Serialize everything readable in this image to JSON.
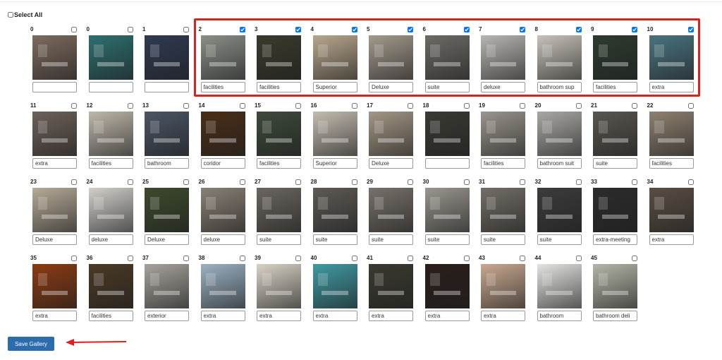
{
  "select_all_label": "Select All",
  "save_button": "Save Gallery",
  "annotation_color": "#e11d1d",
  "images": [
    {
      "id": "0",
      "caption": "",
      "checked": false,
      "tone": "#7d6b5e"
    },
    {
      "id": "0",
      "caption": "",
      "checked": false,
      "tone": "#2e6f70"
    },
    {
      "id": "1",
      "caption": "",
      "checked": false,
      "tone": "#2f3a52"
    },
    {
      "id": "2",
      "caption": "facilities",
      "checked": true,
      "tone": "#8a8f87"
    },
    {
      "id": "3",
      "caption": "facilities",
      "checked": true,
      "tone": "#3a3a2c"
    },
    {
      "id": "4",
      "caption": "Superior",
      "checked": true,
      "tone": "#b9a78d"
    },
    {
      "id": "5",
      "caption": "Deluxe",
      "checked": true,
      "tone": "#a39a8c"
    },
    {
      "id": "6",
      "caption": "suite",
      "checked": true,
      "tone": "#6e6b66"
    },
    {
      "id": "7",
      "caption": "deluxe",
      "checked": true,
      "tone": "#b8b6b2"
    },
    {
      "id": "8",
      "caption": "bathroom sup",
      "checked": true,
      "tone": "#c7c2b9"
    },
    {
      "id": "9",
      "caption": "facilities",
      "checked": true,
      "tone": "#2d3b2f"
    },
    {
      "id": "10",
      "caption": "extra",
      "checked": true,
      "tone": "#4a7480"
    },
    {
      "id": "11",
      "caption": "extra",
      "checked": false,
      "tone": "#6d6259"
    },
    {
      "id": "12",
      "caption": "facilities",
      "checked": false,
      "tone": "#bfb7aa"
    },
    {
      "id": "13",
      "caption": "bathroom",
      "checked": false,
      "tone": "#4a5564"
    },
    {
      "id": "14",
      "caption": "coridor",
      "checked": false,
      "tone": "#4a2e18"
    },
    {
      "id": "15",
      "caption": "facilities",
      "checked": false,
      "tone": "#3d4a3a"
    },
    {
      "id": "16",
      "caption": "Superior",
      "checked": false,
      "tone": "#c4bcb0"
    },
    {
      "id": "17",
      "caption": "Deluxe",
      "checked": false,
      "tone": "#a49886"
    },
    {
      "id": "18",
      "caption": "",
      "checked": false,
      "tone": "#3a3a34"
    },
    {
      "id": "19",
      "caption": "facilities",
      "checked": false,
      "tone": "#9a958c"
    },
    {
      "id": "20",
      "caption": "bathroom suit",
      "checked": false,
      "tone": "#a9a8a4"
    },
    {
      "id": "21",
      "caption": "suite",
      "checked": false,
      "tone": "#5a5650"
    },
    {
      "id": "22",
      "caption": "facilities",
      "checked": false,
      "tone": "#8f8170"
    },
    {
      "id": "23",
      "caption": "Deluxe",
      "checked": false,
      "tone": "#b7ab98"
    },
    {
      "id": "24",
      "caption": "deluxe",
      "checked": false,
      "tone": "#d3d0cb"
    },
    {
      "id": "25",
      "caption": "Deluxe",
      "checked": false,
      "tone": "#3d4a2d"
    },
    {
      "id": "26",
      "caption": "deluxe",
      "checked": false,
      "tone": "#8a8175"
    },
    {
      "id": "27",
      "caption": "suite",
      "checked": false,
      "tone": "#6b6660"
    },
    {
      "id": "28",
      "caption": "suite",
      "checked": false,
      "tone": "#5e5a55"
    },
    {
      "id": "29",
      "caption": "suite",
      "checked": false,
      "tone": "#77716a"
    },
    {
      "id": "30",
      "caption": "suite",
      "checked": false,
      "tone": "#9a968f"
    },
    {
      "id": "31",
      "caption": "suite",
      "checked": false,
      "tone": "#736e67"
    },
    {
      "id": "32",
      "caption": "suite",
      "checked": false,
      "tone": "#3c3c3c"
    },
    {
      "id": "33",
      "caption": "extra-meeting",
      "checked": false,
      "tone": "#2c2c2e"
    },
    {
      "id": "34",
      "caption": "extra",
      "checked": false,
      "tone": "#5a4e43"
    },
    {
      "id": "35",
      "caption": "extra",
      "checked": false,
      "tone": "#8c3b12"
    },
    {
      "id": "36",
      "caption": "facilities",
      "checked": false,
      "tone": "#4b3a25"
    },
    {
      "id": "37",
      "caption": "exterior",
      "checked": false,
      "tone": "#a7a39c"
    },
    {
      "id": "38",
      "caption": "extra",
      "checked": false,
      "tone": "#9bb2c4"
    },
    {
      "id": "39",
      "caption": "extra",
      "checked": false,
      "tone": "#d9d3c6"
    },
    {
      "id": "40",
      "caption": "extra",
      "checked": false,
      "tone": "#3f9aa3"
    },
    {
      "id": "41",
      "caption": "extra",
      "checked": false,
      "tone": "#3b3a30"
    },
    {
      "id": "42",
      "caption": "extra",
      "checked": false,
      "tone": "#2a1e1a"
    },
    {
      "id": "43",
      "caption": "extra",
      "checked": false,
      "tone": "#c9a890"
    },
    {
      "id": "44",
      "caption": "bathroom",
      "checked": false,
      "tone": "#e3e3e1"
    },
    {
      "id": "45",
      "caption": "bathroom deli",
      "checked": false,
      "tone": "#b5b6a8"
    }
  ]
}
